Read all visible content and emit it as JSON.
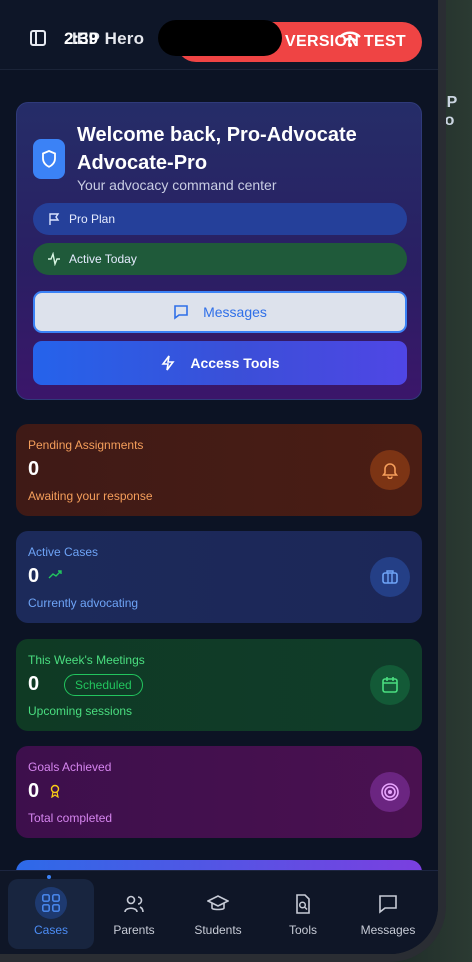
{
  "status_bar": {
    "time": "2:39"
  },
  "topbar": {
    "app_title": "IEP Hero",
    "version_badge": "APP VERSION TEST"
  },
  "welcome": {
    "heading": "Welcome back, Pro-Advocate Advocate-Pro",
    "subtitle": "Your advocacy command center",
    "plan_label": "Pro Plan",
    "activity_label": "Active Today",
    "messages_button": "Messages",
    "tools_button": "Access Tools"
  },
  "stats": [
    {
      "label": "Pending Assignments",
      "value": "0",
      "sub": "Awaiting your response",
      "icon": "bell-icon",
      "color": "#f59e5b"
    },
    {
      "label": "Active Cases",
      "value": "0",
      "sub": "Currently advocating",
      "icon": "briefcase-icon",
      "color": "#6ea4f7"
    },
    {
      "label": "This Week's Meetings",
      "value": "0",
      "badge": "Scheduled",
      "sub": "Upcoming sessions",
      "icon": "calendar-icon",
      "color": "#4ade80"
    },
    {
      "label": "Goals Achieved",
      "value": "0",
      "sub": "Total completed",
      "icon": "target-icon",
      "color": "#d685ef"
    }
  ],
  "nav": {
    "items": [
      {
        "label": "Cases",
        "icon": "grid-icon",
        "active": true
      },
      {
        "label": "Parents",
        "icon": "users-icon",
        "active": false
      },
      {
        "label": "Students",
        "icon": "graduation-cap-icon",
        "active": false
      },
      {
        "label": "Tools",
        "icon": "file-search-icon",
        "active": false
      },
      {
        "label": "Messages",
        "icon": "message-icon",
        "active": false
      }
    ]
  },
  "edge_text": "EP To",
  "colors": {
    "accent": "#3b82f6",
    "badge_red": "#ef4444",
    "background": "#0c1324"
  }
}
